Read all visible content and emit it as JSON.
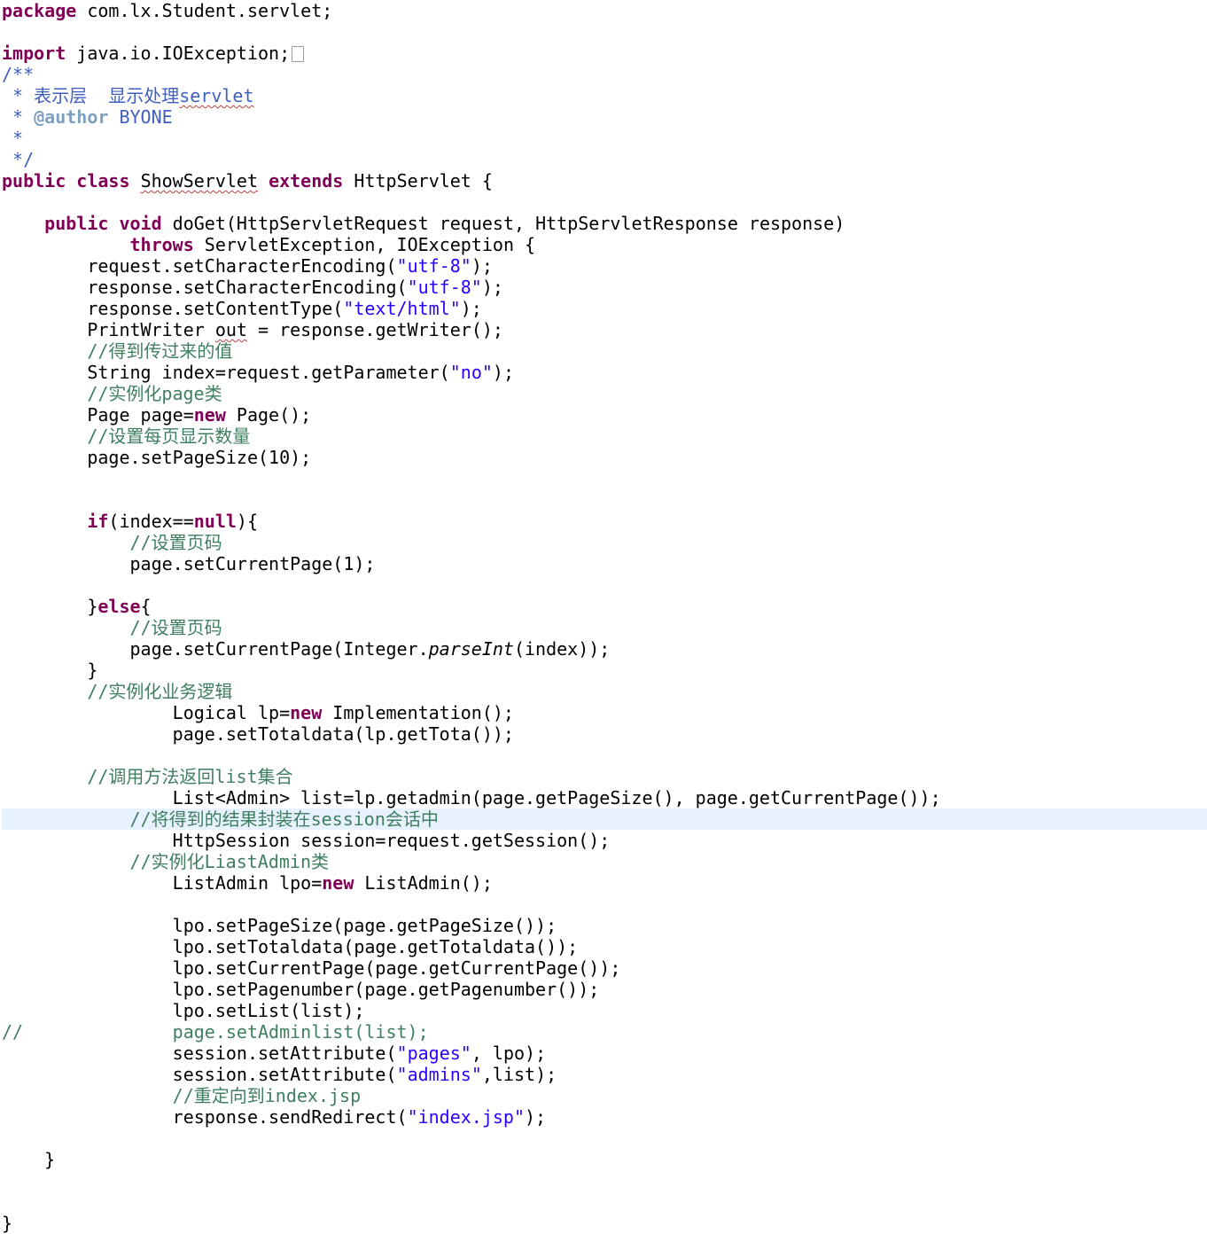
{
  "editor": {
    "file_language": "java",
    "current_line_index": 38,
    "lines": [
      [
        {
          "t": "package",
          "c": "kw"
        },
        {
          "t": " com.lx.Student.servlet;"
        }
      ],
      [],
      [
        {
          "t": "import",
          "c": "kw"
        },
        {
          "t": " java.io.IOException;"
        },
        {
          "t": "",
          "c": "fold"
        }
      ],
      [
        {
          "t": "/**",
          "c": "doc"
        }
      ],
      [
        {
          "t": " * 表示层  显示处理",
          "c": "doc"
        },
        {
          "t": "servlet",
          "c": "doc sq"
        }
      ],
      [
        {
          "t": " * ",
          "c": "doc"
        },
        {
          "t": "@author",
          "c": "tag"
        },
        {
          "t": " BYONE",
          "c": "doc"
        }
      ],
      [
        {
          "t": " *",
          "c": "doc"
        }
      ],
      [
        {
          "t": " */",
          "c": "doc"
        }
      ],
      [
        {
          "t": "public",
          "c": "kw"
        },
        {
          "t": " "
        },
        {
          "t": "class",
          "c": "kw"
        },
        {
          "t": " "
        },
        {
          "t": "ShowServlet",
          "c": "sq"
        },
        {
          "t": " "
        },
        {
          "t": "extends",
          "c": "kw"
        },
        {
          "t": " HttpServlet {"
        }
      ],
      [],
      [
        {
          "t": "    "
        },
        {
          "t": "public",
          "c": "kw"
        },
        {
          "t": " "
        },
        {
          "t": "void",
          "c": "kw"
        },
        {
          "t": " doGet(HttpServletRequest request, HttpServletResponse response)"
        }
      ],
      [
        {
          "t": "            "
        },
        {
          "t": "throws",
          "c": "kw"
        },
        {
          "t": " ServletException, IOException {"
        }
      ],
      [
        {
          "t": "        request.setCharacterEncoding("
        },
        {
          "t": "\"utf-8\"",
          "c": "str"
        },
        {
          "t": ");"
        }
      ],
      [
        {
          "t": "        response.setCharacterEncoding("
        },
        {
          "t": "\"utf-8\"",
          "c": "str"
        },
        {
          "t": ");"
        }
      ],
      [
        {
          "t": "        response.setContentType("
        },
        {
          "t": "\"text/html\"",
          "c": "str"
        },
        {
          "t": ");"
        }
      ],
      [
        {
          "t": "        PrintWriter "
        },
        {
          "t": "out",
          "c": "sq"
        },
        {
          "t": " = response.getWriter();"
        }
      ],
      [
        {
          "t": "        //得到传过来的值",
          "c": "com"
        }
      ],
      [
        {
          "t": "        String index=request.getParameter("
        },
        {
          "t": "\"no\"",
          "c": "str"
        },
        {
          "t": ");"
        }
      ],
      [
        {
          "t": "        //实例化page类",
          "c": "com"
        }
      ],
      [
        {
          "t": "        Page page="
        },
        {
          "t": "new",
          "c": "kw"
        },
        {
          "t": " Page();"
        }
      ],
      [
        {
          "t": "        //设置每页显示数量",
          "c": "com"
        }
      ],
      [
        {
          "t": "        page.setPageSize(10);"
        }
      ],
      [],
      [],
      [
        {
          "t": "        "
        },
        {
          "t": "if",
          "c": "kw"
        },
        {
          "t": "(index=="
        },
        {
          "t": "null",
          "c": "kw"
        },
        {
          "t": "){"
        }
      ],
      [
        {
          "t": "            //设置页码",
          "c": "com"
        }
      ],
      [
        {
          "t": "            page.setCurrentPage(1);"
        }
      ],
      [],
      [
        {
          "t": "        }"
        },
        {
          "t": "else",
          "c": "kw"
        },
        {
          "t": "{"
        }
      ],
      [
        {
          "t": "            //设置页码",
          "c": "com"
        }
      ],
      [
        {
          "t": "            page.setCurrentPage(Integer."
        },
        {
          "t": "parseInt",
          "c": "it"
        },
        {
          "t": "(index));"
        }
      ],
      [
        {
          "t": "        }"
        }
      ],
      [
        {
          "t": "        //实例化业务逻辑",
          "c": "com"
        }
      ],
      [
        {
          "t": "                Logical lp="
        },
        {
          "t": "new",
          "c": "kw"
        },
        {
          "t": " Implementation();"
        }
      ],
      [
        {
          "t": "                page.setTotaldata(lp.getTota());"
        }
      ],
      [],
      [
        {
          "t": "        //调用方法返回list集合",
          "c": "com"
        }
      ],
      [
        {
          "t": "                List<Admin> list=lp.getadmin(page.getPageSize(), page.getCurrentPage());"
        }
      ],
      [
        {
          "t": "            //将得到的结果封装在session会话中",
          "c": "com"
        }
      ],
      [
        {
          "t": "                HttpSession session=request.getSession();"
        }
      ],
      [
        {
          "t": "            //实例化LiastAdmin类",
          "c": "com"
        }
      ],
      [
        {
          "t": "                ListAdmin lpo="
        },
        {
          "t": "new",
          "c": "kw"
        },
        {
          "t": " ListAdmin();"
        }
      ],
      [],
      [
        {
          "t": "                lpo.setPageSize(page.getPageSize());"
        }
      ],
      [
        {
          "t": "                lpo.setTotaldata(page.getTotaldata());"
        }
      ],
      [
        {
          "t": "                lpo.setCurrentPage(page.getCurrentPage());"
        }
      ],
      [
        {
          "t": "                lpo.setPagenumber(page.getPagenumber());"
        }
      ],
      [
        {
          "t": "                lpo.setList(list);"
        }
      ],
      [
        {
          "t": "//              page.setAdminlist(list);",
          "c": "com"
        }
      ],
      [
        {
          "t": "                session.setAttribute("
        },
        {
          "t": "\"pages\"",
          "c": "str"
        },
        {
          "t": ", lpo);"
        }
      ],
      [
        {
          "t": "                session.setAttribute("
        },
        {
          "t": "\"admins\"",
          "c": "str"
        },
        {
          "t": ",list);"
        }
      ],
      [
        {
          "t": "                //重定向到index.jsp",
          "c": "com"
        }
      ],
      [
        {
          "t": "                response.sendRedirect("
        },
        {
          "t": "\"index.jsp\"",
          "c": "str"
        },
        {
          "t": ");"
        }
      ],
      [],
      [
        {
          "t": "    }"
        }
      ],
      [],
      [],
      [
        {
          "t": "}"
        }
      ]
    ]
  }
}
